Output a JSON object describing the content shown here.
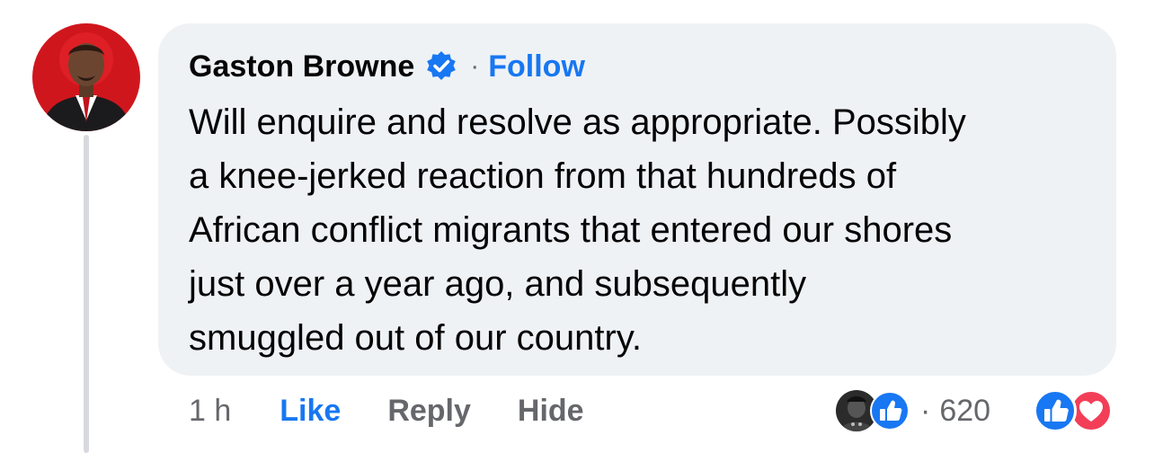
{
  "comment": {
    "author": "Gaston Browne",
    "verified_icon": "verified-badge-icon",
    "separator": "·",
    "follow_label": "Follow",
    "text": "Will enquire and resolve as appropriate. Possibly\na knee-jerked reaction from that hundreds of\nAfrican conflict migrants that entered our shores\njust over a year ago, and subsequently\nsmuggled out of our country."
  },
  "actions": {
    "time": "1 h",
    "like_label": "Like",
    "reply_label": "Reply",
    "hide_label": "Hide"
  },
  "reactions": {
    "separator": "·",
    "count": "620",
    "icons": [
      "like-reaction-icon",
      "love-reaction-icon"
    ]
  },
  "colors": {
    "accent": "#1877f2",
    "bubble": "#eff2f5",
    "secondary_text": "#65676b",
    "love": "#f33e58"
  }
}
